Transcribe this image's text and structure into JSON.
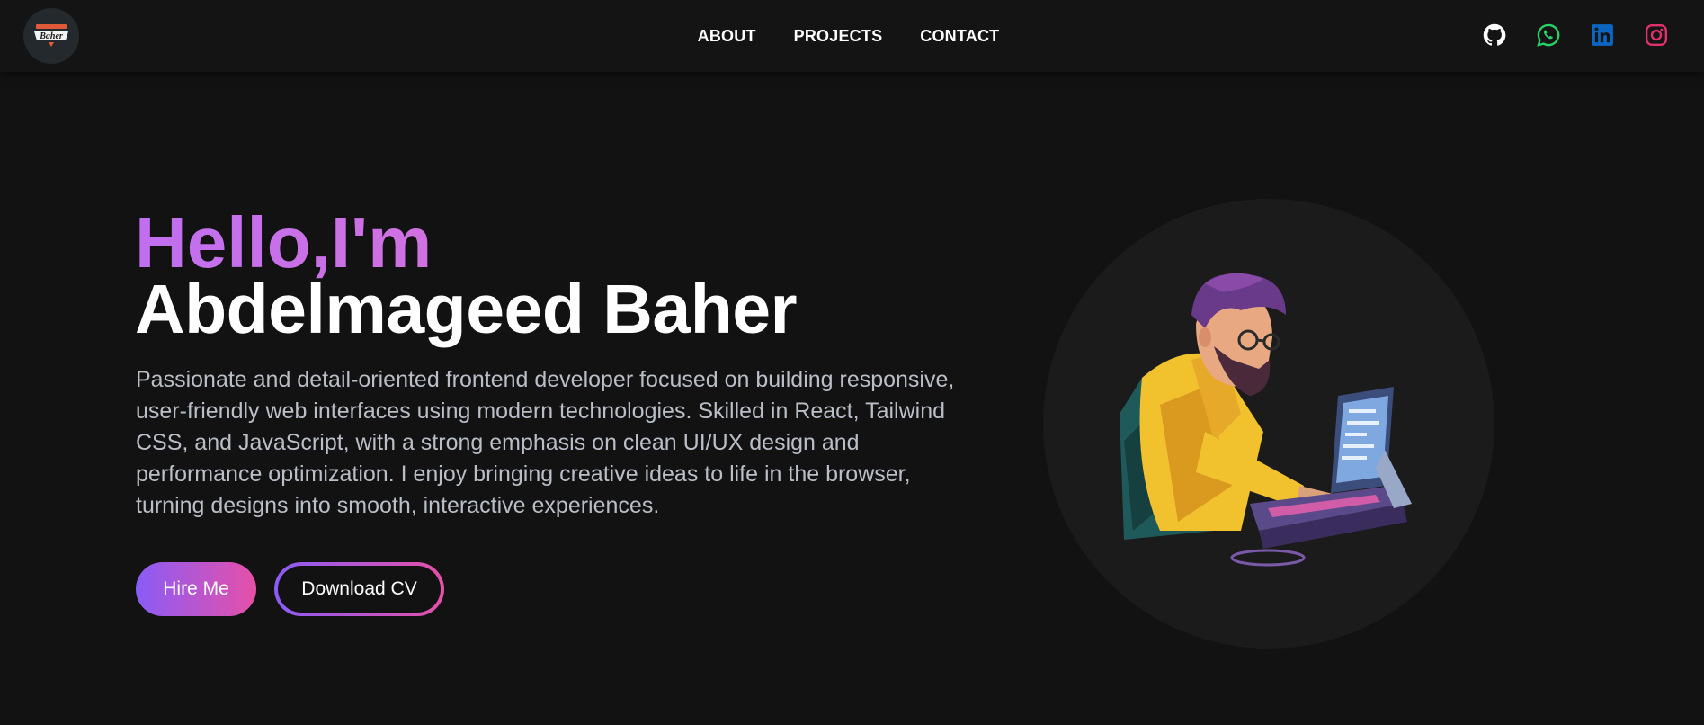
{
  "header": {
    "logo": {
      "text": "Baher",
      "icon": "logo-badge"
    },
    "nav": [
      "ABOUT",
      "PROJECTS",
      "CONTACT"
    ],
    "socials": [
      {
        "name": "github-icon",
        "color": "#ffffff"
      },
      {
        "name": "whatsapp-icon",
        "color": "#25d366"
      },
      {
        "name": "linkedin-icon",
        "color": "#0a66c2"
      },
      {
        "name": "instagram-icon",
        "color": "#e1306c"
      }
    ]
  },
  "hero": {
    "greeting": "Hello,I'm",
    "name": "Abdelmageed Baher",
    "bio": "Passionate and detail-oriented frontend developer focused on building responsive, user-friendly web interfaces using modern technologies. Skilled in React, Tailwind CSS, and JavaScript, with a strong emphasis on clean UI/UX design and performance optimization. I enjoy bringing creative ideas to life in the browser, turning designs into smooth, interactive experiences.",
    "buttons": {
      "hire": "Hire Me",
      "cv": "Download CV"
    },
    "colors": {
      "accent_start": "#8a5cf6",
      "accent_end": "#e650a8",
      "greeting": "#c471ed"
    }
  }
}
